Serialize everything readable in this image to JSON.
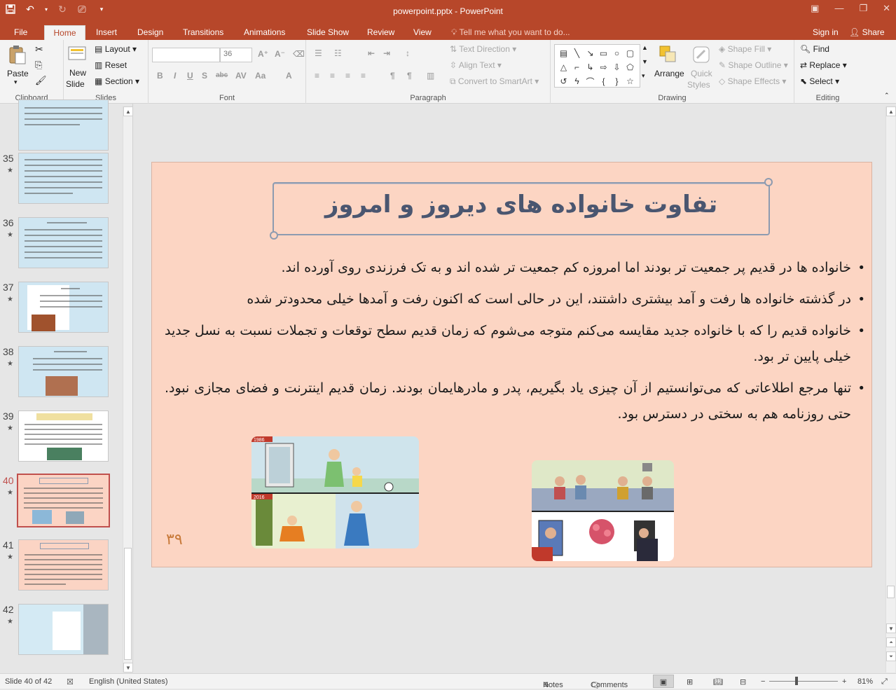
{
  "window": {
    "title": "powerpoint.pptx - PowerPoint",
    "controls": [
      "restore-icon",
      "minimize-icon",
      "maximize-icon",
      "close-icon"
    ]
  },
  "tabs": [
    "File",
    "Home",
    "Insert",
    "Design",
    "Transitions",
    "Animations",
    "Slide Show",
    "Review",
    "View"
  ],
  "active_tab": "Home",
  "tell_me": "Tell me what you want to do...",
  "account": {
    "sign_in": "Sign in",
    "share": "Share"
  },
  "ribbon": {
    "clipboard": {
      "label": "Clipboard",
      "paste": "Paste"
    },
    "slides": {
      "label": "Slides",
      "new_slide_1": "New",
      "new_slide_2": "Slide",
      "layout": "Layout",
      "reset": "Reset",
      "section": "Section"
    },
    "font": {
      "label": "Font",
      "font_name": "",
      "font_size": "36"
    },
    "paragraph": {
      "label": "Paragraph",
      "text_direction": "Text Direction",
      "align_text": "Align Text",
      "smartart": "Convert to SmartArt"
    },
    "drawing": {
      "label": "Drawing",
      "arrange": "Arrange",
      "quick_styles_1": "Quick",
      "quick_styles_2": "Styles",
      "shape_fill": "Shape Fill",
      "shape_outline": "Shape Outline",
      "shape_effects": "Shape Effects"
    },
    "editing": {
      "label": "Editing",
      "find": "Find",
      "replace": "Replace",
      "select": "Select"
    }
  },
  "thumbnails": [
    {
      "num": "",
      "selected": false
    },
    {
      "num": "35",
      "selected": false
    },
    {
      "num": "36",
      "selected": false
    },
    {
      "num": "37",
      "selected": false
    },
    {
      "num": "38",
      "selected": false
    },
    {
      "num": "39",
      "selected": false
    },
    {
      "num": "40",
      "selected": true
    },
    {
      "num": "41",
      "selected": false
    },
    {
      "num": "42",
      "selected": false
    }
  ],
  "slide": {
    "title": "تفاوت خانواده های دیروز و امروز",
    "bullets": [
      "خانواده ها در قدیم پر جمعیت تر بودند اما امروزه کم جمعیت تر شده اند و به تک فرزندی روی آورده اند.",
      "در گذشته خانواده ها رفت و آمد بیشتری داشتند، این در حالی است که اکنون رفت و آمدها خیلی محدودتر شده",
      "خانواده قدیم را که با خانواده جدید مقایسه می‌کنم متوجه می‌شوم که زمان قدیم  سطح توقعات و تجملات نسبت به نسل جدید خیلی پایین تر بود.",
      " تنها مرجع اطلاعاتی که می‌توانستیم از آن چیزی یاد بگیریم، پدر و مادرهایمان بودند. زمان قدیم اینترنت و فضای مجازی نبود. حتی روزنامه هم به سختی در دسترس بود."
    ],
    "page_number": "۳۹",
    "image_left_labels": [
      "1986",
      "2016"
    ]
  },
  "status": {
    "slide_of": "Slide 40 of 42",
    "language": "English (United States)",
    "notes": "Notes",
    "comments": "Comments",
    "zoom": "81%"
  },
  "colors": {
    "accent": "#b7472a",
    "slide_bg": "#fcd5c3",
    "title_text": "#4a5670",
    "selected_thumb": "#c0504d"
  }
}
